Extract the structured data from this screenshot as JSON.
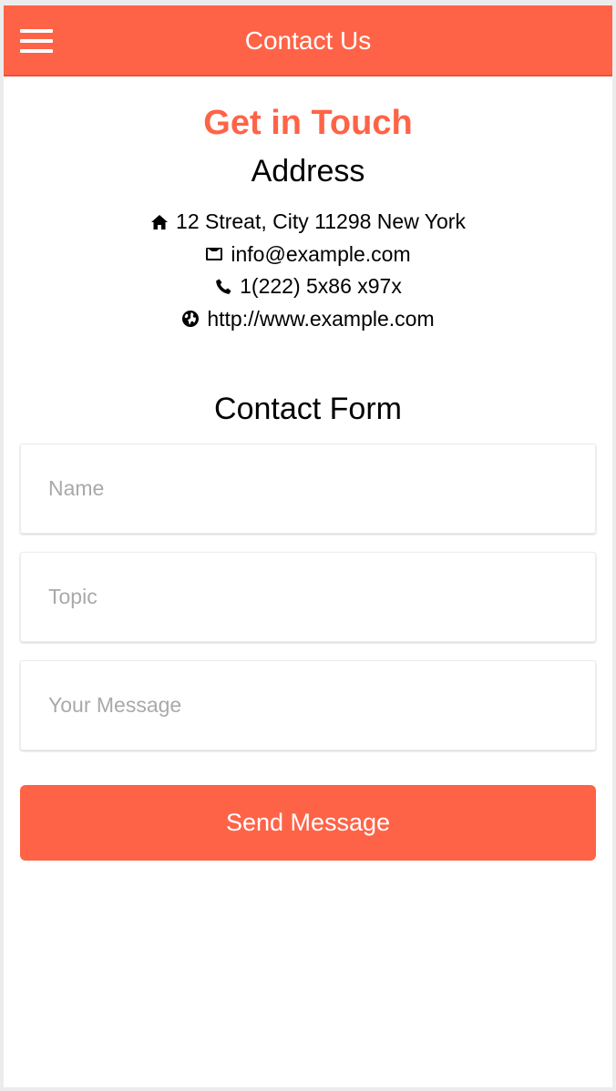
{
  "header": {
    "title": "Contact Us",
    "menu_icon": "hamburger-menu-icon",
    "background_color": "#ff6347"
  },
  "main": {
    "heading": "Get in Touch",
    "address_title": "Address",
    "contact_lines": [
      {
        "icon": "home-icon",
        "text": "12 Streat, City 11298 New York"
      },
      {
        "icon": "envelope-icon",
        "text": "info@example.com"
      },
      {
        "icon": "phone-icon",
        "text": "1(222) 5x86 x97x"
      },
      {
        "icon": "globe-icon",
        "text": "http://www.example.com"
      }
    ],
    "form_title": "Contact Form",
    "form": {
      "name_placeholder": "Name",
      "topic_placeholder": "Topic",
      "message_placeholder": "Your Message",
      "submit_label": "Send Message"
    }
  },
  "colors": {
    "accent": "#ff6347",
    "placeholder": "#a9a9a9"
  }
}
